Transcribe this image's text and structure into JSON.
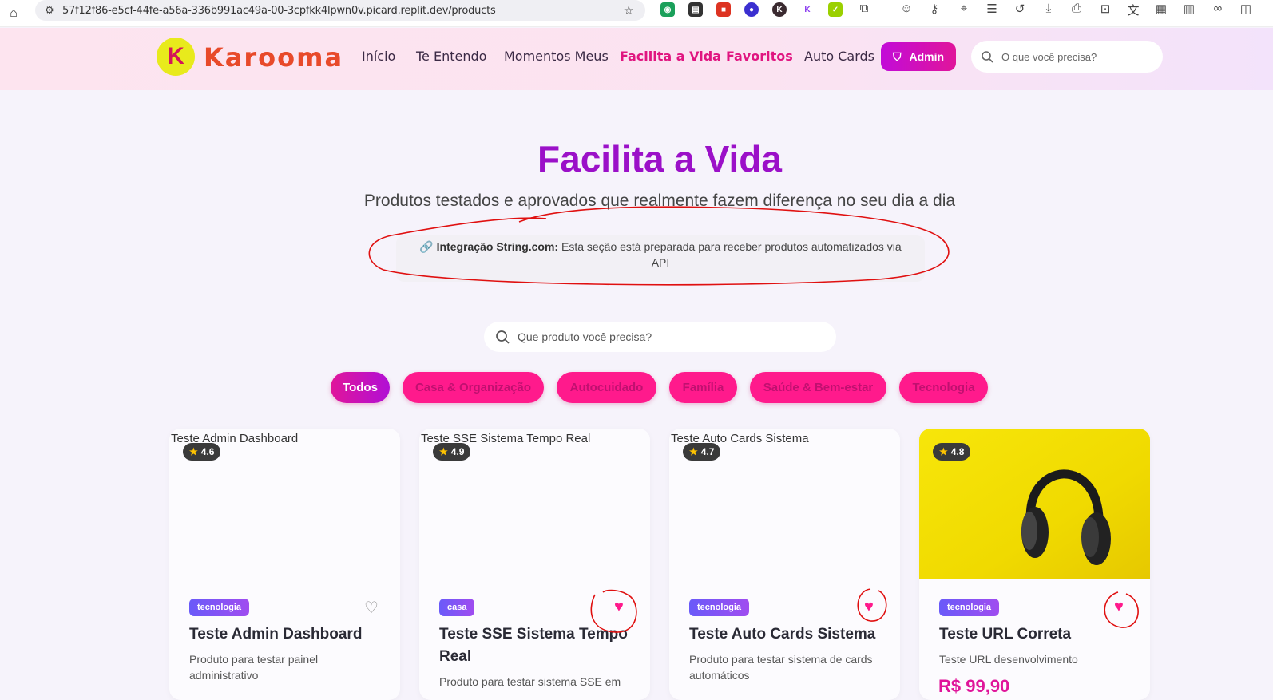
{
  "browser": {
    "url": "57f12f86-e5cf-44fe-a56a-336b991ac49a-00-3cpfkk4lpwn0v.picard.replit.dev/products"
  },
  "header": {
    "logo_text": "Karooma",
    "nav": [
      {
        "label": "Início"
      },
      {
        "label": "Te Entendo"
      },
      {
        "label": "Momentos Meus"
      },
      {
        "label": "Facilita a Vida"
      },
      {
        "label": "Favoritos"
      },
      {
        "label": "Auto Cards"
      }
    ],
    "admin_label": "Admin",
    "search_placeholder": "O que você precisa?"
  },
  "hero": {
    "title": "Facilita a Vida",
    "subtitle": "Produtos testados e aprovados que realmente fazem diferença no seu dia a dia",
    "notice_label": "Integração String.com:",
    "notice_text": "Esta seção está preparada para receber produtos automatizados via API"
  },
  "search": {
    "placeholder": "Que produto você precisa?"
  },
  "filters": [
    {
      "label": "Todos"
    },
    {
      "label": "Casa & Organização"
    },
    {
      "label": "Autocuidado"
    },
    {
      "label": "Família"
    },
    {
      "label": "Saúde & Bem-estar"
    },
    {
      "label": "Tecnologia"
    }
  ],
  "products": [
    {
      "image_alt": "Teste Admin Dashboard",
      "rating": "4.6",
      "category": "tecnologia",
      "title": "Teste Admin Dashboard",
      "description": "Produto para testar painel administrativo",
      "favorited": false
    },
    {
      "image_alt": "Teste SSE Sistema Tempo Real",
      "rating": "4.9",
      "category": "casa",
      "title": "Teste SSE Sistema Tempo Real",
      "description": "Produto para testar sistema SSE em",
      "favorited": true
    },
    {
      "image_alt": "Teste Auto Cards Sistema",
      "rating": "4.7",
      "category": "tecnologia",
      "title": "Teste Auto Cards Sistema",
      "description": "Produto para testar sistema de cards automáticos",
      "favorited": true
    },
    {
      "image_alt": "",
      "rating": "4.8",
      "category": "tecnologia",
      "title": "Teste URL Correta",
      "description": "Teste URL desenvolvimento",
      "price": "R$ 99,90",
      "favorited": true
    }
  ],
  "colors": {
    "brand_purple": "#9b10c8",
    "brand_pink": "#e0159a",
    "annotation_red": "#e01010"
  }
}
